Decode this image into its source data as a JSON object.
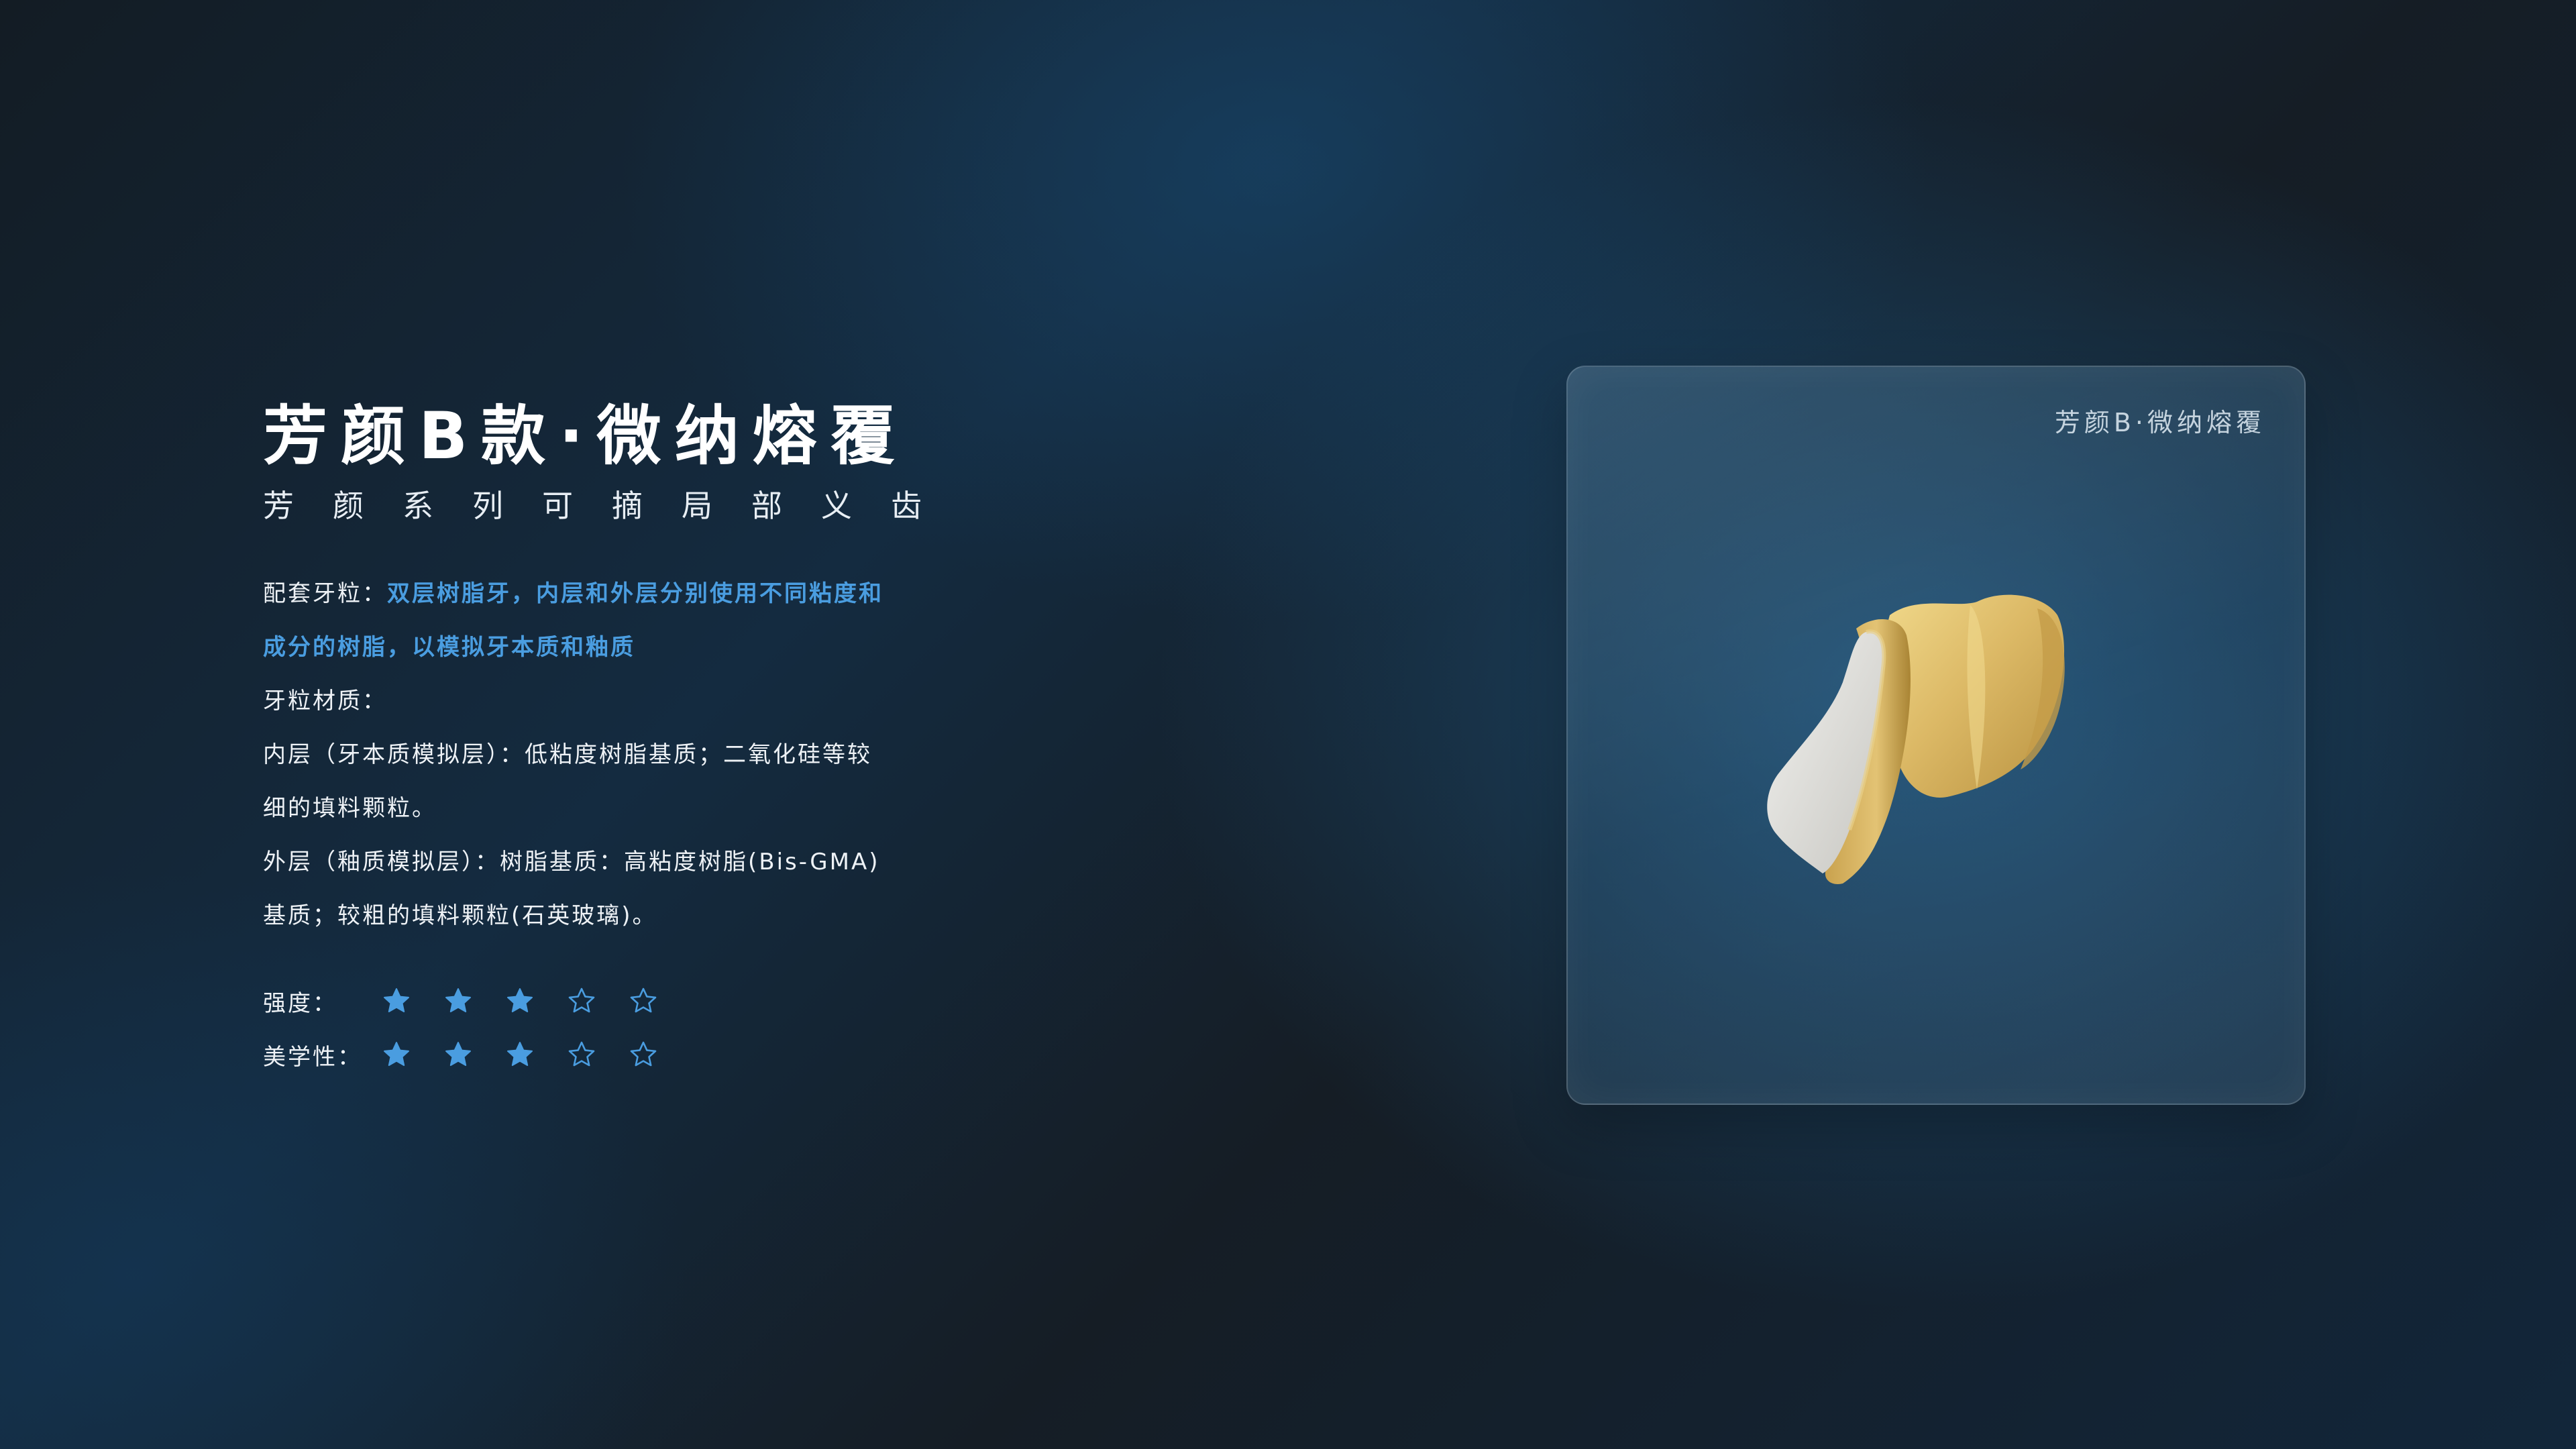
{
  "title": "芳颜B款·微纳熔覆",
  "subtitle": "芳颜系列可摘局部义齿",
  "description": {
    "matching_label": "配套牙粒：",
    "matching_text_1": "双层树脂牙，内层和外层分别使用不同粘度和",
    "matching_text_2": "成分的树脂，以模拟牙本质和釉质",
    "material_label": "牙粒材质：",
    "inner_1": "内层（牙本质模拟层）：低粘度树脂基质；二氧化硅等较",
    "inner_2": "细的填料颗粒。",
    "outer_1": "外层（釉质模拟层）：树脂基质：高粘度树脂(Bis-GMA)",
    "outer_2": "基质；较粗的填料颗粒(石英玻璃)。"
  },
  "ratings": [
    {
      "label": "强度：",
      "value": 3,
      "max": 5
    },
    {
      "label": "美学性：",
      "value": 3,
      "max": 5
    }
  ],
  "card": {
    "label": "芳颜B·微纳熔覆"
  },
  "colors": {
    "accent": "#4a9de0",
    "star_filled": "#4a9de0",
    "star_empty_stroke": "#4a9de0",
    "tooth_gold": "#d8b565",
    "tooth_white": "#d9d9d6"
  },
  "icons": {
    "star_filled": "star-filled-icon",
    "star_empty": "star-outline-icon"
  }
}
